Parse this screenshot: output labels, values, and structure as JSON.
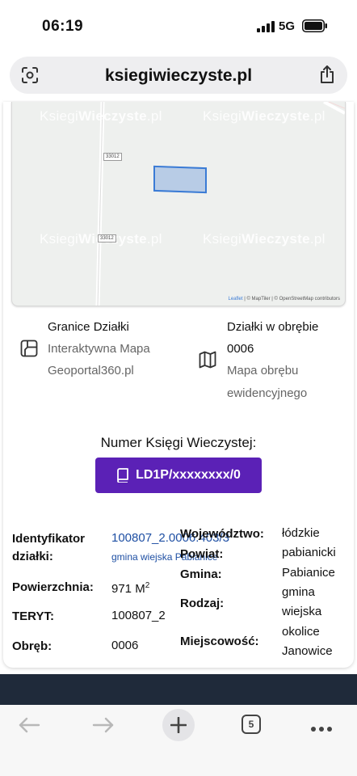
{
  "status_bar": {
    "time": "06:19",
    "network": "5G"
  },
  "browser": {
    "url": "ksiegiwieczyste.pl",
    "tab_count": "5"
  },
  "map": {
    "watermark_a": "Ksiegi",
    "watermark_b": "Wieczyste",
    "watermark_c": ".pl",
    "road_label_1": "33012",
    "road_label_2": "33012",
    "attribution_leaflet": "Leaflet",
    "attribution_rest": " | © MapTiler | © OpenStreetMap contributors"
  },
  "info_left": {
    "title": "Granice Działki",
    "line1": "Interaktywna Mapa",
    "line2": "Geoportal360.pl"
  },
  "info_right": {
    "title1": "Działki w obrębie",
    "title2": "0006",
    "line1": "Mapa obrębu",
    "line2": "ewidencyjnego"
  },
  "kw": {
    "heading": "Numer Księgi Wieczystej:",
    "button": "LD1P/xxxxxxxx/0"
  },
  "details": {
    "identyfikator_label1": "Identyfikator",
    "identyfikator_label2": "działki:",
    "identyfikator_value": "100807_2.0006.403/3",
    "identyfikator_sub": "gmina wiejska Pabianice",
    "powierzchnia_label": "Powierzchnia:",
    "powierzchnia_value": "971 M",
    "powierzchnia_sup": "2",
    "teryt_label": "TERYT:",
    "teryt_value": "100807_2",
    "obreb_label": "Obręb:",
    "obreb_value": "0006",
    "wojewodztwo_label": "Województwo:",
    "wojewodztwo_value": "łódzkie",
    "powiat_label": "Powiat:",
    "powiat_value": "pabianicki",
    "gmina_label": "Gmina:",
    "gmina_value": "Pabianice",
    "rodzaj_label": "Rodzaj:",
    "rodzaj_value1": "gmina",
    "rodzaj_value2": "wiejska",
    "miejscowosc_label": "Miejscowość:",
    "miejscowosc_value1": "okolice",
    "miejscowosc_value2": "Janowice"
  },
  "colors": {
    "accent": "#5b21b6",
    "link": "#1e4fa3",
    "parcel": "#3a7bd5"
  }
}
